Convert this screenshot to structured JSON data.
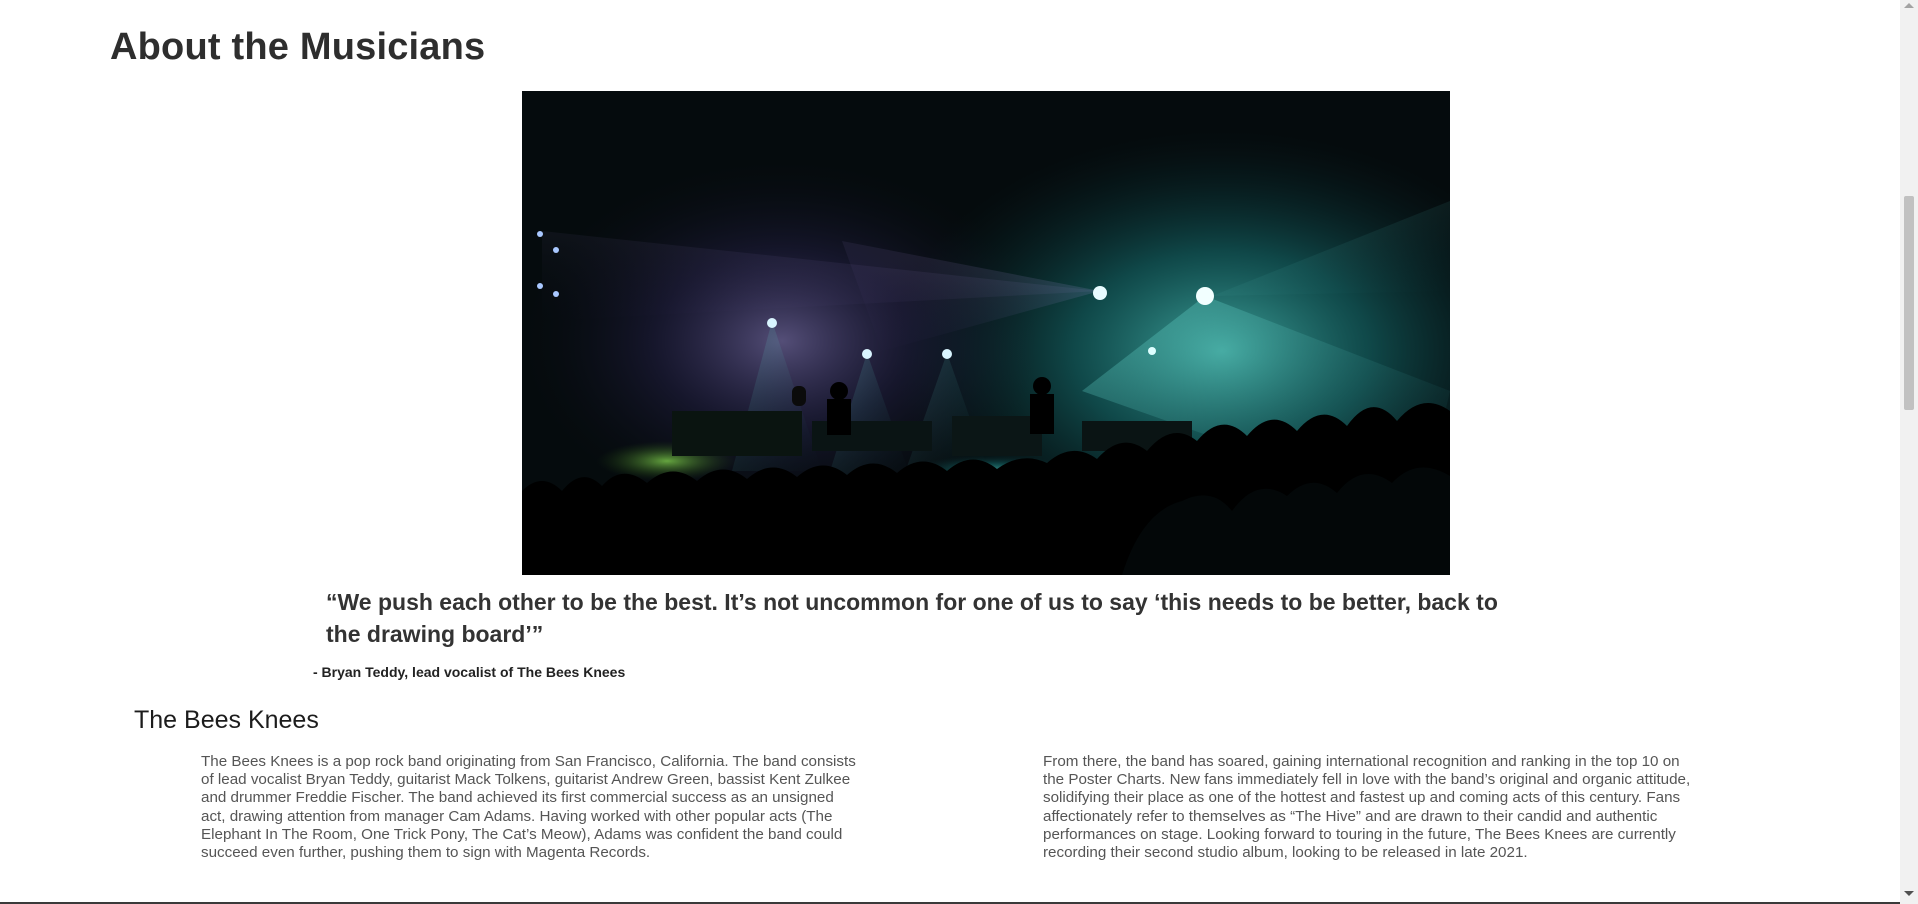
{
  "section": {
    "title": "About the Musicians"
  },
  "hero": {
    "alt": "Band performing on a dark stage under teal and violet spotlights with the crowd in silhouette"
  },
  "quote": {
    "text": "“We push each other to be the best. It’s not uncommon for one of us to say ‘this needs to be better, back to the drawing board’”",
    "attribution": "- Bryan Teddy, lead vocalist of The Bees Knees"
  },
  "band": {
    "title": "The Bees Knees",
    "paragraph_left": "The Bees Knees is a pop rock band originating from San Francisco, California. The band consists of lead vocalist Bryan Teddy, guitarist Mack Tolkens, guitarist Andrew Green, bassist Kent Zulkee and drummer Freddie Fischer. The band achieved its first commercial success as an unsigned act, drawing attention from manager Cam Adams. Having worked with other popular acts (The Elephant In The Room, One Trick Pony, The Cat’s Meow), Adams was confident the band could succeed even further, pushing them to sign with Magenta Records.",
    "paragraph_right": "From there, the band has soared, gaining international recognition and ranking in the top 10 on the Poster Charts. New fans immediately fell in love with the band’s original and organic attitude, solidifying their place as one of the hottest and fastest up and coming acts of this century. Fans affectionately refer to themselves as “The Hive” and are drawn to their candid and authentic performances on stage. Looking forward to touring in the future, The Bees Knees are currently recording their second studio album, looking to be released in late 2021."
  },
  "colors": {
    "text": "#2e2e2e",
    "body_text": "#555555",
    "stage_teal": "#3fd6c8",
    "stage_violet": "#8a6cff"
  }
}
